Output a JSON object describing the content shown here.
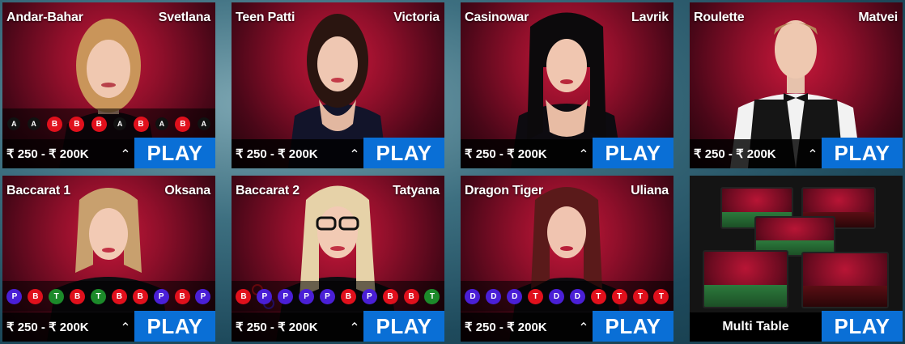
{
  "colors": {
    "play_button": "#0a6fd6",
    "bead_red": "#e0101c",
    "bead_black": "#111111",
    "bead_blue": "#4a1fd6",
    "bead_green": "#1c8a2a"
  },
  "tiles": [
    {
      "game": "Andar-Bahar",
      "dealer": "Svetlana",
      "limit": "₹ 250 - ₹ 200K",
      "play": "PLAY",
      "beads": [
        {
          "t": "A",
          "c": "black"
        },
        {
          "t": "A",
          "c": "black"
        },
        {
          "t": "B",
          "c": "red"
        },
        {
          "t": "B",
          "c": "red"
        },
        {
          "t": "B",
          "c": "red"
        },
        {
          "t": "A",
          "c": "black"
        },
        {
          "t": "B",
          "c": "red"
        },
        {
          "t": "A",
          "c": "black"
        },
        {
          "t": "B",
          "c": "red"
        },
        {
          "t": "A",
          "c": "black"
        }
      ]
    },
    {
      "game": "Teen Patti",
      "dealer": "Victoria",
      "limit": "₹ 250 - ₹ 200K",
      "play": "PLAY",
      "beads": []
    },
    {
      "game": "Casinowar",
      "dealer": "Lavrik",
      "limit": "₹ 250 - ₹ 200K",
      "play": "PLAY",
      "beads": []
    },
    {
      "game": "Roulette",
      "dealer": "Matvei",
      "limit": "₹ 250 - ₹ 200K",
      "play": "PLAY",
      "beads": []
    },
    {
      "game": "Baccarat 1",
      "dealer": "Oksana",
      "limit": "₹ 250 - ₹ 200K",
      "play": "PLAY",
      "beads": [
        {
          "t": "P",
          "c": "blue"
        },
        {
          "t": "B",
          "c": "red"
        },
        {
          "t": "T",
          "c": "green"
        },
        {
          "t": "B",
          "c": "red"
        },
        {
          "t": "T",
          "c": "green"
        },
        {
          "t": "B",
          "c": "red"
        },
        {
          "t": "B",
          "c": "red"
        },
        {
          "t": "P",
          "c": "blue"
        },
        {
          "t": "B",
          "c": "red"
        },
        {
          "t": "P",
          "c": "blue"
        }
      ]
    },
    {
      "game": "Baccarat 2",
      "dealer": "Tatyana",
      "limit": "₹ 250 - ₹ 200K",
      "play": "PLAY",
      "beads": [
        {
          "t": "B",
          "c": "red"
        },
        {
          "t": "P",
          "c": "blue"
        },
        {
          "t": "P",
          "c": "blue"
        },
        {
          "t": "P",
          "c": "blue"
        },
        {
          "t": "P",
          "c": "blue"
        },
        {
          "t": "B",
          "c": "red"
        },
        {
          "t": "P",
          "c": "blue"
        },
        {
          "t": "B",
          "c": "red"
        },
        {
          "t": "B",
          "c": "red"
        },
        {
          "t": "T",
          "c": "green"
        }
      ]
    },
    {
      "game": "Dragon Tiger",
      "dealer": "Uliana",
      "limit": "₹ 250 - ₹ 200K",
      "play": "PLAY",
      "beads": [
        {
          "t": "D",
          "c": "blue"
        },
        {
          "t": "D",
          "c": "blue"
        },
        {
          "t": "D",
          "c": "blue"
        },
        {
          "t": "T",
          "c": "red"
        },
        {
          "t": "D",
          "c": "blue"
        },
        {
          "t": "D",
          "c": "blue"
        },
        {
          "t": "T",
          "c": "red"
        },
        {
          "t": "T",
          "c": "red"
        },
        {
          "t": "T",
          "c": "red"
        },
        {
          "t": "T",
          "c": "red"
        }
      ]
    }
  ],
  "multi_table": {
    "label": "Multi Table",
    "play": "PLAY"
  }
}
